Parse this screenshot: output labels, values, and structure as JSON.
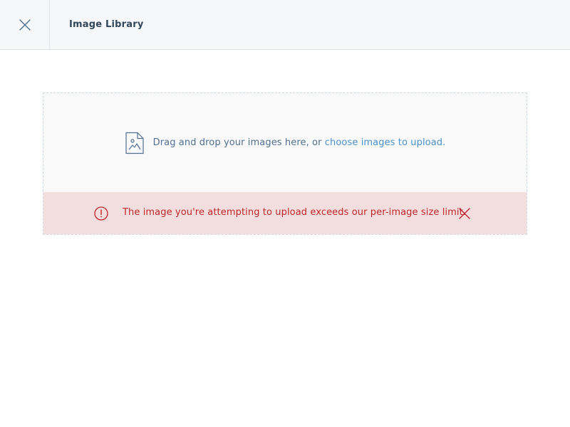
{
  "header": {
    "title": "Image Library",
    "close_icon": "close-icon"
  },
  "dropzone": {
    "icon": "image-file-icon",
    "prompt_text": "Drag and drop your images here, or ",
    "link_text": "choose images to upload."
  },
  "error": {
    "icon": "alert-circle-icon",
    "message": "The image you're attempting to upload exceeds our per-image size limit.",
    "dismiss_icon": "close-icon"
  },
  "colors": {
    "header_bg": "#f5f7f9",
    "text_dark": "#33475b",
    "text_muted": "#516f90",
    "link": "#4a90c9",
    "error_bg": "#f2dede",
    "error_text": "#c0252b"
  }
}
